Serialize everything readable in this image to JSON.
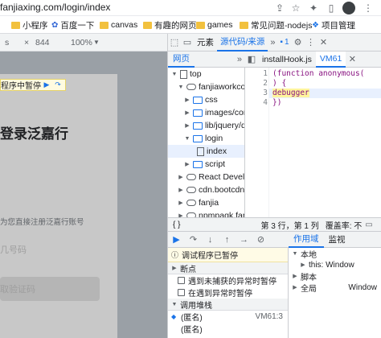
{
  "browser": {
    "url": "fanjiaxing.com/login/index",
    "bookmarks": [
      {
        "label": "小程序",
        "icon": "folder"
      },
      {
        "label": "百度一下",
        "icon": "paw"
      },
      {
        "label": "canvas",
        "icon": "folder"
      },
      {
        "label": "有趣的网页",
        "icon": "folder"
      },
      {
        "label": "games",
        "icon": "folder"
      },
      {
        "label": "常见问题-nodejs",
        "icon": "folder"
      },
      {
        "label": "项目管理",
        "icon": "folder"
      }
    ]
  },
  "device_toolbar": {
    "width": "844",
    "zoom": "100%"
  },
  "page": {
    "paused_text": "程序中暂停",
    "title": "登录泛嘉行",
    "tip": "为您直接注册泛嘉行账号",
    "phone_placeholder": "几号码",
    "code_placeholder": "取验证码"
  },
  "devtools": {
    "tabs": [
      "元素",
      "源代码/来源"
    ],
    "active_tab": "源代码/来源",
    "message_count": "1",
    "nav_tab": "网页",
    "tree": [
      {
        "label": "top",
        "depth": 0,
        "kind": "frame",
        "open": true
      },
      {
        "label": "fanjiaworkcoin",
        "depth": 1,
        "kind": "cloud",
        "open": true
      },
      {
        "label": "css",
        "depth": 2,
        "kind": "folder",
        "open": false
      },
      {
        "label": "images/com",
        "depth": 2,
        "kind": "folder",
        "open": false
      },
      {
        "label": "lib/jquery/d",
        "depth": 2,
        "kind": "folder",
        "open": false
      },
      {
        "label": "login",
        "depth": 2,
        "kind": "folder",
        "open": true
      },
      {
        "label": "index",
        "depth": 3,
        "kind": "file",
        "open": false,
        "selected": true
      },
      {
        "label": "script",
        "depth": 2,
        "kind": "folder",
        "open": false
      },
      {
        "label": "React Develop",
        "depth": 1,
        "kind": "cloud",
        "open": false
      },
      {
        "label": "cdn.bootcdn.n",
        "depth": 1,
        "kind": "cloud",
        "open": false
      },
      {
        "label": "fanjia",
        "depth": 1,
        "kind": "cloud",
        "open": false
      },
      {
        "label": "npmpagk.fanji",
        "depth": 1,
        "kind": "cloud",
        "open": false
      }
    ],
    "editor_tabs": [
      "installHook.js",
      "VM61"
    ],
    "active_editor_tab": "VM61",
    "code_lines": [
      {
        "n": "1",
        "text": "(function anonymous("
      },
      {
        "n": "2",
        "text": ") {"
      },
      {
        "n": "3",
        "text": "debugger"
      },
      {
        "n": "4",
        "text": "})"
      }
    ],
    "status": {
      "braces": "{ }",
      "position": "第 3 行，第 1 列",
      "coverage": "覆盖率: 不"
    },
    "paused_message": "调试程序已暂停",
    "sections": {
      "breakpoints": "断点",
      "exceptions": [
        "遇到未捕获的异常时暂停",
        "在遇到异常时暂停"
      ],
      "call_stack": "调用堆栈"
    },
    "frames": [
      {
        "name": "(匿名)",
        "loc": "VM61:3",
        "current": true
      },
      {
        "name": "(匿名)",
        "loc": ""
      }
    ],
    "scope_tabs": [
      "作用域",
      "监视"
    ],
    "active_scope_tab": "作用域",
    "scope": [
      {
        "label": "本地",
        "open": true,
        "indent": 0
      },
      {
        "label": "this: Window",
        "open": false,
        "indent": 1
      },
      {
        "label": "脚本",
        "open": false,
        "indent": 0
      },
      {
        "label": "全局",
        "open": false,
        "indent": 0,
        "value": "Window"
      }
    ]
  },
  "colors": {
    "accent": "#1a73e8",
    "paused_banner": "#fffbe0",
    "highlight": "#fff59d"
  }
}
